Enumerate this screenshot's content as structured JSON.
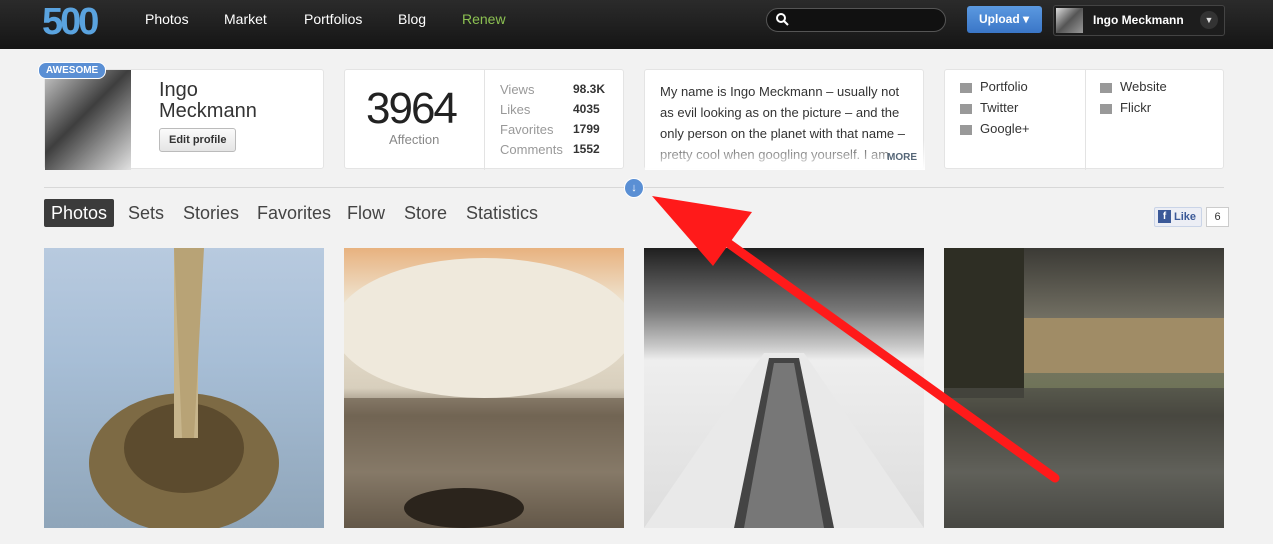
{
  "header": {
    "logo": "500",
    "nav": [
      "Photos",
      "Market",
      "Portfolios",
      "Blog",
      "Renew"
    ],
    "search_placeholder": "",
    "upload_label": "Upload ▾",
    "user_name": "Ingo Meckmann",
    "accent": "#5aa3df",
    "renew_color": "#8cc152"
  },
  "profile": {
    "badge": "AWESOME",
    "name_line1": "Ingo",
    "name_line2": "Meckmann",
    "edit_label": "Edit profile"
  },
  "affection": {
    "value": "3964",
    "label": "Affection",
    "stats": [
      {
        "label": "Views",
        "value": "98.3K"
      },
      {
        "label": "Likes",
        "value": "4035"
      },
      {
        "label": "Favorites",
        "value": "1799"
      },
      {
        "label": "Comments",
        "value": "1552"
      }
    ]
  },
  "bio": {
    "text": "My name is Ingo Meckmann – usually not as evil looking as on the picture – and the only person on the planet with that name – pretty cool when googling yourself. I am",
    "more": "MORE"
  },
  "links": {
    "left": [
      "Portfolio",
      "Twitter",
      "Google+"
    ],
    "right": [
      "Website",
      "Flickr"
    ]
  },
  "tabs": [
    "Photos",
    "Sets",
    "Stories",
    "Favorites",
    "Flow",
    "Store",
    "Statistics"
  ],
  "facebook": {
    "like_label": "Like",
    "count": "6"
  },
  "photos": [
    "pelican",
    "trees-lake",
    "building",
    "town-reflection"
  ]
}
